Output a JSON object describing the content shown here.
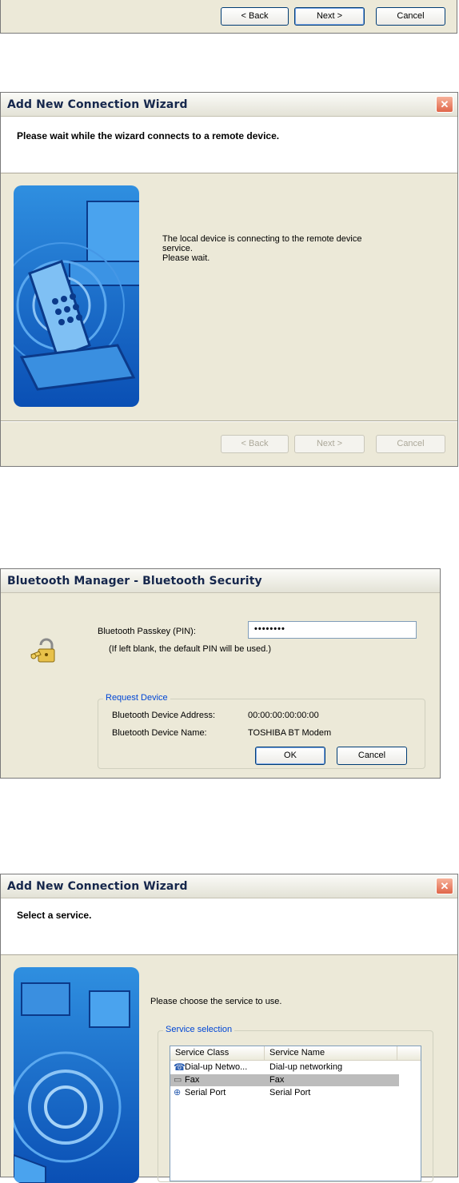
{
  "wizard1_bottom": {
    "buttons": {
      "back": "< Back",
      "next": "Next >",
      "cancel": "Cancel"
    }
  },
  "wizard2": {
    "title": "Add New Connection Wizard",
    "header": "Please wait while the wizard connects to a remote device.",
    "body_lines": [
      "The local device is connecting to the remote device",
      "service.",
      "Please wait."
    ],
    "buttons": {
      "back": "< Back",
      "next": "Next >",
      "cancel": "Cancel"
    }
  },
  "security_dialog": {
    "title": "Bluetooth Manager - Bluetooth Security",
    "passkey_label": "Bluetooth Passkey (PIN):",
    "passkey_value": "••••••••",
    "hint": "(If left blank, the default PIN will be used.)",
    "group_label": "Request Device",
    "address_label": "Bluetooth Device Address:",
    "address_value": "00:00:00:00:00:00",
    "name_label": "Bluetooth Device Name:",
    "name_value": "TOSHIBA BT Modem",
    "buttons": {
      "ok": "OK",
      "cancel": "Cancel"
    }
  },
  "wizard3": {
    "title": "Add New Connection Wizard",
    "header": "Select a service.",
    "prompt": "Please choose the service to use.",
    "group_label": "Service selection",
    "columns": [
      "Service Class",
      "Service Name"
    ],
    "rows": [
      {
        "class": "Dial-up Netwo...",
        "name": "Dial-up networking",
        "icon": "dialup-icon",
        "selected": false
      },
      {
        "class": "Fax",
        "name": "Fax",
        "icon": "fax-icon",
        "selected": true
      },
      {
        "class": "Serial Port",
        "name": "Serial Port",
        "icon": "serial-port-icon",
        "selected": false
      }
    ]
  },
  "colors": {
    "dialog_bg": "#ece9d8",
    "title_text": "#16274c",
    "close_button": "#e0664a",
    "group_label": "#0046d5"
  }
}
